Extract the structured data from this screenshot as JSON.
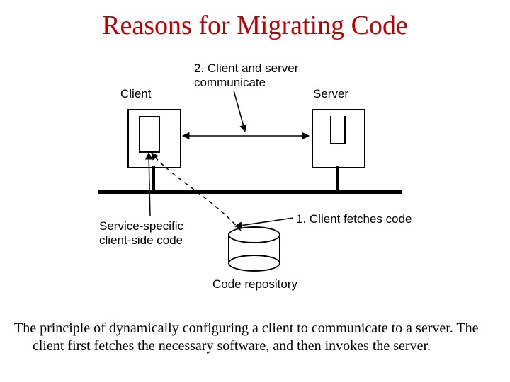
{
  "title": "Reasons for Migrating Code",
  "labels": {
    "client": "Client",
    "server": "Server",
    "step2": "2. Client and server\ncommunicate",
    "step1": "1. Client fetches code",
    "service_code": "Service-specific\nclient-side code",
    "repo": "Code repository"
  },
  "caption": "The principle of dynamically configuring a client to communicate to a server.  The client first fetches the necessary software, and then invokes the server."
}
